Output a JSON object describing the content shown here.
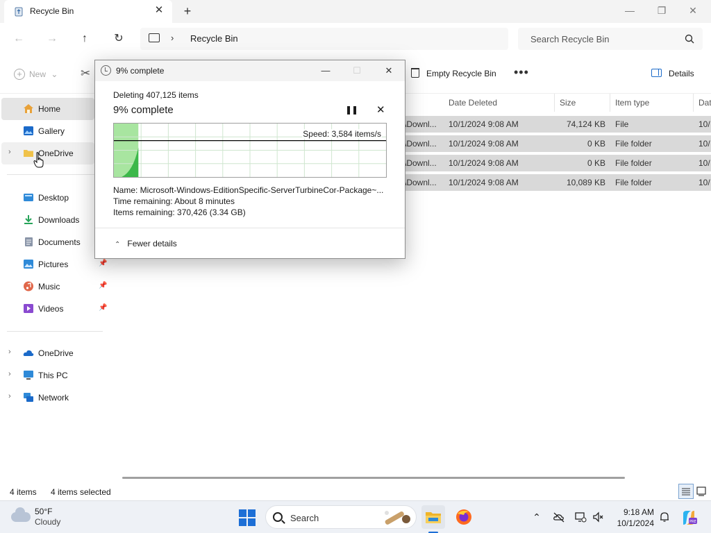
{
  "window": {
    "tab_title": "Recycle Bin",
    "tab_close": "✕",
    "new_tab": "+",
    "minimize": "—",
    "restore": "❐",
    "close": "✕"
  },
  "nav": {
    "back": "←",
    "forward": "→",
    "up": "↑",
    "refresh": "↻",
    "breadcrumb_chevron": "›",
    "address_path": "Recycle Bin",
    "search_placeholder": "Search Recycle Bin"
  },
  "toolbar": {
    "new_label": "New",
    "new_dropdown": "⌄",
    "cut_glyph": "✂",
    "empty_label": "Empty Recycle Bin",
    "more_glyph": "•••",
    "details_label": "Details"
  },
  "sidebar": {
    "quick": [
      {
        "label": "Home",
        "icon": "home-icon",
        "color": "#e8a23a"
      },
      {
        "label": "Gallery",
        "icon": "gallery-icon",
        "color": "#1b6ac9"
      },
      {
        "label": "OneDrive",
        "icon": "folder-icon",
        "color": "#f0c24a"
      }
    ],
    "pinned": [
      {
        "label": "Desktop",
        "icon": "desktop-icon",
        "color": "#2f8ad8"
      },
      {
        "label": "Downloads",
        "icon": "downloads-icon",
        "color": "#27a45a"
      },
      {
        "label": "Documents",
        "icon": "documents-icon",
        "color": "#8a95a8"
      },
      {
        "label": "Pictures",
        "icon": "pictures-icon",
        "color": "#2f8ad8"
      },
      {
        "label": "Music",
        "icon": "music-icon",
        "color": "#e0674a"
      },
      {
        "label": "Videos",
        "icon": "videos-icon",
        "color": "#8a4ad0"
      }
    ],
    "pin_glyph": "📌",
    "locations": [
      {
        "label": "OneDrive",
        "icon": "onedrive-cloud-icon",
        "color": "#1b6ac9"
      },
      {
        "label": "This PC",
        "icon": "this-pc-icon",
        "color": "#2f8ad8"
      },
      {
        "label": "Network",
        "icon": "network-icon",
        "color": "#2f8ad8"
      }
    ],
    "expand_glyph": "›"
  },
  "table": {
    "columns": [
      "Date Deleted",
      "Size",
      "Item type",
      "Dat"
    ],
    "rows": [
      {
        "origin": "\\Downl...",
        "date": "10/1/2024 9:08 AM",
        "size": "74,124 KB",
        "type": "File",
        "dat": "10/"
      },
      {
        "origin": "\\Downl...",
        "date": "10/1/2024 9:08 AM",
        "size": "0 KB",
        "type": "File folder",
        "dat": "10/"
      },
      {
        "origin": "\\Downl...",
        "date": "10/1/2024 9:08 AM",
        "size": "0 KB",
        "type": "File folder",
        "dat": "10/"
      },
      {
        "origin": "\\Downl...",
        "date": "10/1/2024 9:08 AM",
        "size": "10,089 KB",
        "type": "File folder",
        "dat": "10/"
      }
    ]
  },
  "status": {
    "items": "4 items",
    "selected": "4 items selected"
  },
  "dialog": {
    "title": "9% complete",
    "minimize": "—",
    "maximize": "☐",
    "close": "✕",
    "deleting": "Deleting 407,125 items",
    "progress_text": "9% complete",
    "progress_fraction": 0.09,
    "pause_glyph": "❚❚",
    "cancel_glyph": "✕",
    "speed": "Speed: 3,584 items/s",
    "name_line": "Name:  Microsoft-Windows-EditionSpecific-ServerTurbineCor-Package~...",
    "time_line": "Time remaining:  About 8 minutes",
    "items_line": "Items remaining:  370,426 (3.34 GB)",
    "fewer_glyph": "⌃",
    "fewer_label": "Fewer details",
    "graph_color": "#3cb84a",
    "graph_fill": "#a8e5a0"
  },
  "taskbar": {
    "temp": "50°F",
    "condition": "Cloudy",
    "search_label": "Search",
    "time": "9:18 AM",
    "date": "10/1/2024",
    "tray_up": "⌃",
    "start_color": "#1d6fd6"
  }
}
